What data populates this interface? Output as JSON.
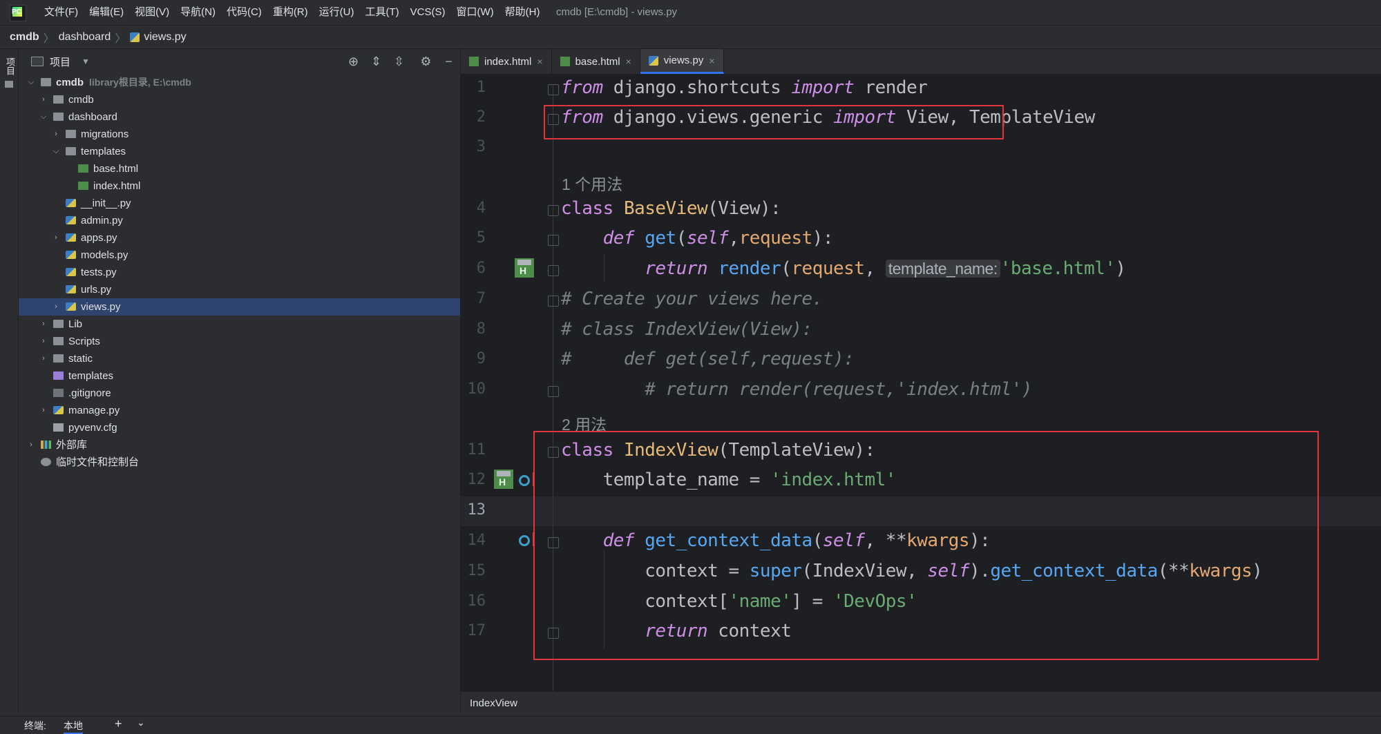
{
  "menu": [
    "文件(F)",
    "编辑(E)",
    "视图(V)",
    "导航(N)",
    "代码(C)",
    "重构(R)",
    "运行(U)",
    "工具(T)",
    "VCS(S)",
    "窗口(W)",
    "帮助(H)"
  ],
  "window_title": "cmdb [E:\\cmdb] - views.py",
  "breadcrumb": [
    "cmdb",
    "dashboard",
    "views.py"
  ],
  "left_strip_label": "项目",
  "project_panel": {
    "title": "项目",
    "tree": [
      {
        "label": "cmdb",
        "hint": "library根目录, E:\\cmdb",
        "depth": 0,
        "arrow": "open",
        "icon": "folder",
        "bold": true
      },
      {
        "label": "cmdb",
        "depth": 1,
        "arrow": "closed",
        "icon": "folder"
      },
      {
        "label": "dashboard",
        "depth": 1,
        "arrow": "open",
        "icon": "folder"
      },
      {
        "label": "migrations",
        "depth": 2,
        "arrow": "closed",
        "icon": "folder"
      },
      {
        "label": "templates",
        "depth": 2,
        "arrow": "open",
        "icon": "folder"
      },
      {
        "label": "base.html",
        "depth": 3,
        "icon": "html"
      },
      {
        "label": "index.html",
        "depth": 3,
        "icon": "html"
      },
      {
        "label": "__init__.py",
        "depth": 2,
        "icon": "py"
      },
      {
        "label": "admin.py",
        "depth": 2,
        "icon": "py"
      },
      {
        "label": "apps.py",
        "depth": 2,
        "arrow": "closed",
        "icon": "py"
      },
      {
        "label": "models.py",
        "depth": 2,
        "icon": "py"
      },
      {
        "label": "tests.py",
        "depth": 2,
        "icon": "py"
      },
      {
        "label": "urls.py",
        "depth": 2,
        "icon": "py"
      },
      {
        "label": "views.py",
        "depth": 2,
        "arrow": "closed",
        "icon": "py",
        "selected": true
      },
      {
        "label": "Lib",
        "depth": 1,
        "arrow": "closed",
        "icon": "folder"
      },
      {
        "label": "Scripts",
        "depth": 1,
        "arrow": "closed",
        "icon": "folder"
      },
      {
        "label": "static",
        "depth": 1,
        "arrow": "closed",
        "icon": "folder"
      },
      {
        "label": "templates",
        "depth": 1,
        "icon": "folder-purple"
      },
      {
        "label": ".gitignore",
        "depth": 1,
        "icon": "git"
      },
      {
        "label": "manage.py",
        "depth": 1,
        "arrow": "closed",
        "icon": "py"
      },
      {
        "label": "pyvenv.cfg",
        "depth": 1,
        "icon": "cfg"
      },
      {
        "label": "外部库",
        "depth": 0,
        "arrow": "closed",
        "icon": "lib"
      },
      {
        "label": "临时文件和控制台",
        "depth": 0,
        "icon": "scratch"
      }
    ]
  },
  "tabs": [
    {
      "label": "index.html",
      "icon": "html",
      "active": false
    },
    {
      "label": "base.html",
      "icon": "html",
      "active": false
    },
    {
      "label": "views.py",
      "icon": "py",
      "active": true
    }
  ],
  "editor": {
    "usages": {
      "baseview": "1 个用法",
      "indexview": "2 用法"
    },
    "inlay_hint": "template_name:",
    "current_line": 13
  },
  "editor_breadcrumb": "IndexView",
  "bottom": {
    "terminal_label": "终端:",
    "local_tab": "本地",
    "add": "+",
    "more": "⌄"
  }
}
